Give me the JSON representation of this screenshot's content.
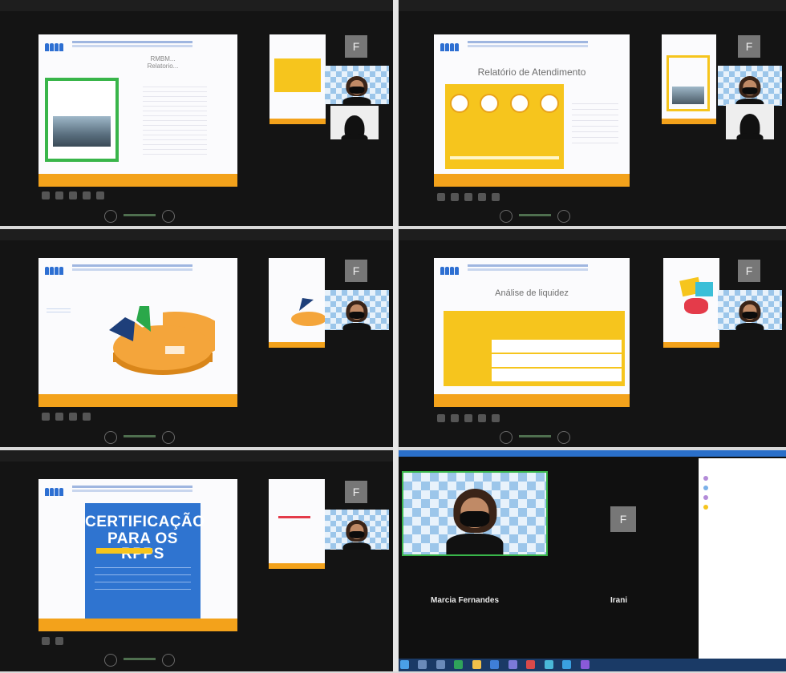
{
  "panels": [
    {
      "id": "p1",
      "slide_title_lines": [
        "RMBM...",
        "Relatorio..."
      ]
    },
    {
      "id": "p2",
      "slide_title": "Relatório de Atendimento"
    },
    {
      "id": "p3"
    },
    {
      "id": "p4",
      "slide_title": "Análise de liquidez"
    },
    {
      "id": "p5",
      "cert_title_1": "CERTIFICAÇÃO",
      "cert_title_2": "PARA OS RPPS"
    },
    {
      "id": "p6"
    }
  ],
  "participants": {
    "presenter_name": "Marcia Fernandes",
    "other_name": "Irani",
    "avatar_letter": "F"
  },
  "colors": {
    "accent_orange": "#f3a21b",
    "accent_yellow": "#f6c51d",
    "accent_blue": "#2f74d0",
    "background_dark": "#141414"
  },
  "icons": [
    "pencil-icon",
    "pointer-icon",
    "mic-icon",
    "camera-icon",
    "share-icon",
    "chevron-left-icon",
    "chevron-right-icon"
  ]
}
